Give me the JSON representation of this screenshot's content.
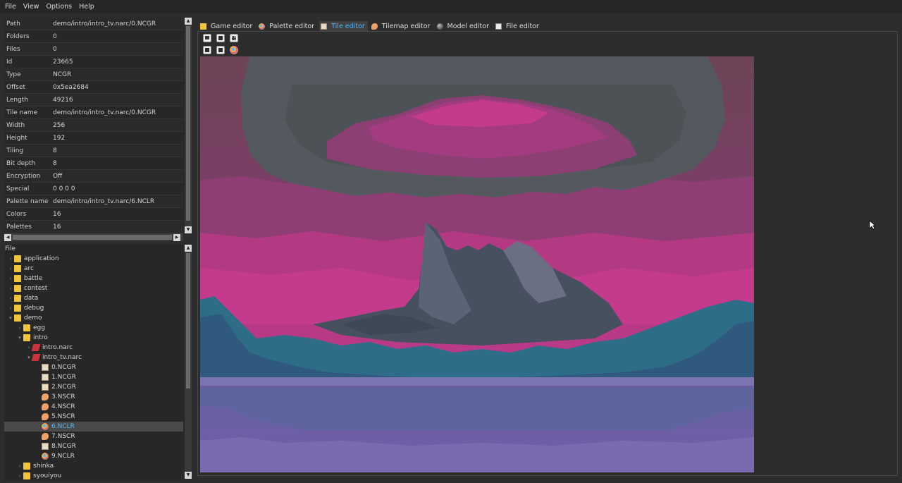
{
  "menu": [
    "File",
    "View",
    "Options",
    "Help"
  ],
  "properties": [
    {
      "key": "Path",
      "value": "demo/intro/intro_tv.narc/0.NCGR"
    },
    {
      "key": "Folders",
      "value": "0"
    },
    {
      "key": "Files",
      "value": "0"
    },
    {
      "key": "Id",
      "value": "23665"
    },
    {
      "key": "Type",
      "value": "NCGR"
    },
    {
      "key": "Offset",
      "value": "0x5ea2684"
    },
    {
      "key": "Length",
      "value": "49216"
    },
    {
      "key": "Tile name",
      "value": "demo/intro/intro_tv.narc/0.NCGR"
    },
    {
      "key": "Width",
      "value": "256"
    },
    {
      "key": "Height",
      "value": "192"
    },
    {
      "key": "Tiling",
      "value": "8"
    },
    {
      "key": "Bit depth",
      "value": "8"
    },
    {
      "key": "Encryption",
      "value": "Off"
    },
    {
      "key": "Special",
      "value": "0 0 0 0"
    },
    {
      "key": "Palette name",
      "value": "demo/intro/intro_tv.narc/6.NCLR"
    },
    {
      "key": "Colors",
      "value": "16"
    },
    {
      "key": "Palettes",
      "value": "16"
    }
  ],
  "tree": {
    "header": "File",
    "items": [
      {
        "label": "application",
        "type": "folder",
        "expanded": false
      },
      {
        "label": "arc",
        "type": "folder",
        "expanded": false
      },
      {
        "label": "battle",
        "type": "folder",
        "expanded": false
      },
      {
        "label": "contest",
        "type": "folder",
        "expanded": false
      },
      {
        "label": "data",
        "type": "folder",
        "expanded": false
      },
      {
        "label": "debug",
        "type": "folder",
        "expanded": false
      },
      {
        "label": "demo",
        "type": "folder",
        "expanded": true
      },
      {
        "label": "egg",
        "type": "folder",
        "expanded": false
      },
      {
        "label": "intro",
        "type": "folder",
        "expanded": true
      },
      {
        "label": "intro.narc",
        "type": "narc",
        "expanded": false
      },
      {
        "label": "intro_tv.narc",
        "type": "narc",
        "expanded": true
      },
      {
        "label": "0.NCGR",
        "type": "ncgr"
      },
      {
        "label": "1.NCGR",
        "type": "ncgr"
      },
      {
        "label": "2.NCGR",
        "type": "ncgr"
      },
      {
        "label": "3.NSCR",
        "type": "nscr"
      },
      {
        "label": "4.NSCR",
        "type": "nscr"
      },
      {
        "label": "5.NSCR",
        "type": "nscr"
      },
      {
        "label": "6.NCLR",
        "type": "nclr",
        "selected": true
      },
      {
        "label": "7.NSCR",
        "type": "nscr"
      },
      {
        "label": "8.NCGR",
        "type": "ncgr"
      },
      {
        "label": "9.NCLR",
        "type": "nclr"
      },
      {
        "label": "shinka",
        "type": "folder",
        "expanded": false
      },
      {
        "label": "syouiyou",
        "type": "folder",
        "expanded": false
      }
    ]
  },
  "tabs": [
    {
      "label": "Game editor",
      "icon": "folder-icon"
    },
    {
      "label": "Palette editor",
      "icon": "palette-icon"
    },
    {
      "label": "Tile editor",
      "icon": "tile-icon",
      "active": true
    },
    {
      "label": "Tilemap editor",
      "icon": "tilemap-icon"
    },
    {
      "label": "Model editor",
      "icon": "model-icon"
    },
    {
      "label": "File editor",
      "icon": "file-icon"
    }
  ],
  "toolbar": [
    {
      "name": "import-image-button",
      "icon": "import-icon"
    },
    {
      "name": "export-image-button",
      "icon": "export-icon"
    },
    {
      "name": "toggle-grid-button",
      "icon": "grid-icon"
    },
    {
      "name": "import-tiles-button",
      "icon": "import-tiles-icon"
    },
    {
      "name": "export-tiles-button",
      "icon": "export-tiles-icon"
    },
    {
      "name": "palette-button",
      "icon": "palette-icon"
    }
  ],
  "colors": {
    "accent": "#4fb8ff",
    "sky_magenta": "#b33a82",
    "cloud_gray": "#545a62",
    "water_purple": "#6a5fa3"
  }
}
